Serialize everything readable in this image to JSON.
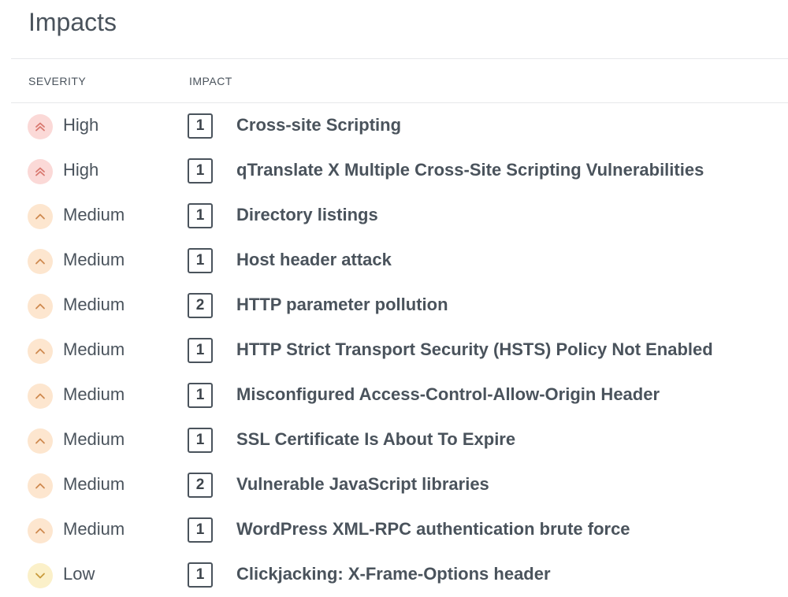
{
  "page": {
    "title": "Impacts"
  },
  "table": {
    "headers": {
      "severity": "SEVERITY",
      "impact": "IMPACT"
    },
    "rows": [
      {
        "severity": "High",
        "count": "1",
        "name": "Cross-site Scripting"
      },
      {
        "severity": "High",
        "count": "1",
        "name": "qTranslate X Multiple Cross-Site Scripting Vulnerabilities"
      },
      {
        "severity": "Medium",
        "count": "1",
        "name": "Directory listings"
      },
      {
        "severity": "Medium",
        "count": "1",
        "name": "Host header attack"
      },
      {
        "severity": "Medium",
        "count": "2",
        "name": "HTTP parameter pollution"
      },
      {
        "severity": "Medium",
        "count": "1",
        "name": "HTTP Strict Transport Security (HSTS) Policy Not Enabled"
      },
      {
        "severity": "Medium",
        "count": "1",
        "name": "Misconfigured Access-Control-Allow-Origin Header"
      },
      {
        "severity": "Medium",
        "count": "1",
        "name": "SSL Certificate Is About To Expire"
      },
      {
        "severity": "Medium",
        "count": "2",
        "name": "Vulnerable JavaScript libraries"
      },
      {
        "severity": "Medium",
        "count": "1",
        "name": "WordPress XML-RPC authentication brute force"
      },
      {
        "severity": "Low",
        "count": "1",
        "name": "Clickjacking: X-Frame-Options header"
      }
    ]
  },
  "severity_styles": {
    "High": {
      "icon": "double-chevron-up-icon",
      "bg": "#fbd9d7",
      "fg": "#d9786f"
    },
    "Medium": {
      "icon": "chevron-up-icon",
      "bg": "#fde6cf",
      "fg": "#cf8a50"
    },
    "Low": {
      "icon": "chevron-down-icon",
      "bg": "#fbf0c9",
      "fg": "#c99b3c"
    }
  }
}
